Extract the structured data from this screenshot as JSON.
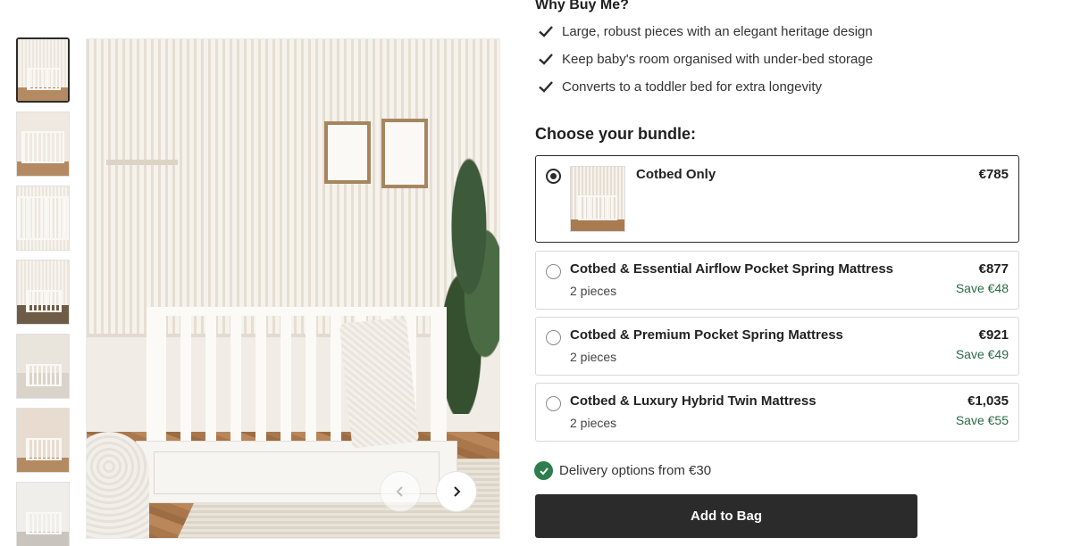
{
  "gallery": {
    "thumbnail_count": 7,
    "active_index": 0
  },
  "why_buy": {
    "title": "Why Buy Me?",
    "benefits": [
      "Large, robust pieces with an elegant heritage design",
      "Keep baby's room organised with under-bed storage",
      "Converts to a toddler bed for extra longevity"
    ]
  },
  "bundle": {
    "title": "Choose your bundle:",
    "options": [
      {
        "name": "Cotbed Only",
        "price": "€785",
        "selected": true
      },
      {
        "name": "Cotbed & Essential Airflow Pocket Spring Mattress",
        "pieces": "2 pieces",
        "price": "€877",
        "save": "Save €48",
        "selected": false
      },
      {
        "name": "Cotbed & Premium Pocket Spring Mattress",
        "pieces": "2 pieces",
        "price": "€921",
        "save": "Save €49",
        "selected": false
      },
      {
        "name": "Cotbed & Luxury Hybrid Twin Mattress",
        "pieces": "2 pieces",
        "price": "€1,035",
        "save": "Save €55",
        "selected": false
      }
    ]
  },
  "delivery": {
    "text": "Delivery options from €30"
  },
  "cta": {
    "add_to_bag": "Add to Bag"
  },
  "colors": {
    "button_bg": "#2b2b2b",
    "save_text": "#2b6b44",
    "delivery_badge": "#2e7d4f",
    "selected_border": "#2b2b2b"
  },
  "icons": {
    "benefit": "check-icon",
    "delivery": "check-circle-icon",
    "prev": "chevron-left-icon",
    "next": "chevron-right-icon"
  }
}
